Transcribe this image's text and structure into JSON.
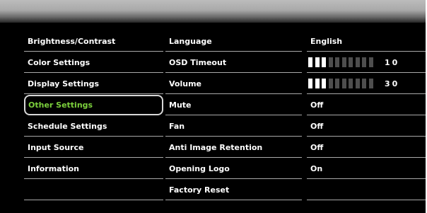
{
  "menu": [
    {
      "label": "Brightness/Contrast"
    },
    {
      "label": "Color Settings"
    },
    {
      "label": "Display Settings"
    },
    {
      "label": "Other Settings"
    },
    {
      "label": "Schedule Settings"
    },
    {
      "label": "Input Source"
    },
    {
      "label": "Information"
    },
    {
      "label": ""
    }
  ],
  "selected_index": 3,
  "colors": {
    "selected_text": "#7cd03c",
    "slider_on": "#ffffff",
    "slider_off": "#4e4e4e",
    "background": "#000000"
  },
  "settings": [
    {
      "label": "Language",
      "value": "English"
    },
    {
      "label": "OSD Timeout",
      "value": "10",
      "slider": {
        "value": 10,
        "max": 100,
        "segments_on": 3,
        "segments_total": 10
      }
    },
    {
      "label": "Volume",
      "value": "30",
      "slider": {
        "value": 30,
        "max": 100,
        "segments_on": 3,
        "segments_total": 10
      }
    },
    {
      "label": "Mute",
      "value": "Off"
    },
    {
      "label": "Fan",
      "value": "Off"
    },
    {
      "label": "Anti Image Retention",
      "value": "Off"
    },
    {
      "label": "Opening Logo",
      "value": "On"
    },
    {
      "label": "Factory Reset",
      "value": ""
    }
  ]
}
